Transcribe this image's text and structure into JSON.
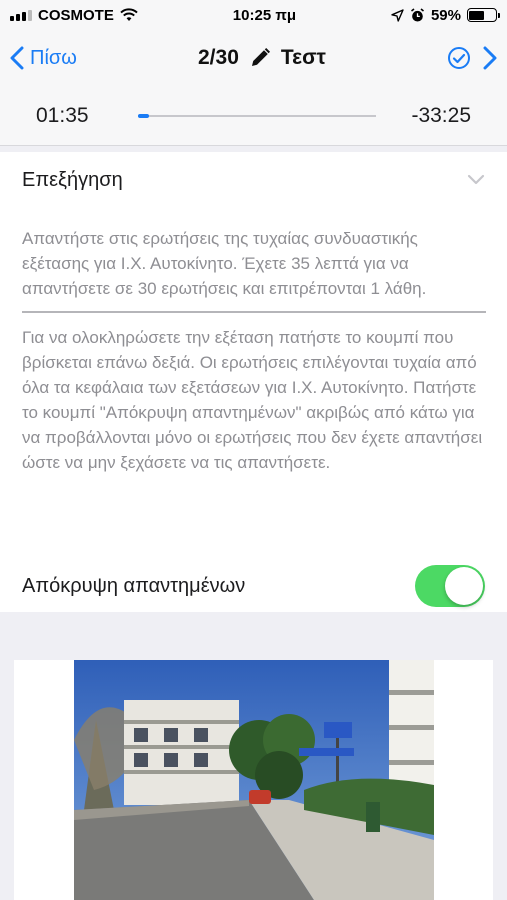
{
  "status_bar": {
    "carrier": "COSMOTE",
    "time": "10:25 πμ",
    "battery_percent": "59%",
    "battery_level": 0.59
  },
  "nav": {
    "back_label": "Πίσω",
    "counter": "2/30",
    "title": "Τεστ"
  },
  "timer": {
    "elapsed": "01:35",
    "remaining": "-33:25",
    "progress": 0.045
  },
  "explanation": {
    "heading": "Επεξήγηση",
    "paragraph_1": "Απαντήστε στις ερωτήσεις της τυχαίας συνδυαστικής εξέτασης για Ι.Χ. Αυτοκίνητο. Έχετε 35 λεπτά για να απαντήσετε σε 30 ερωτήσεις και επιτρέπονται 1 λάθη.",
    "paragraph_2": "Για να ολοκληρώσετε την εξέταση πατήστε το κουμπί που βρίσκεται επάνω δεξιά. Οι ερωτήσεις επιλέγονται τυχαία από όλα τα κεφάλαια των εξετάσεων για Ι.Χ. Αυτοκίνητο. Πατήστε το κουμπί \"Απόκρυψη απαντημένων\" ακριβώς από κάτω για να προβάλλονται μόνο οι ερωτήσεις που δεν έχετε απαντήσει ώστε να μην ξεχάσετε να τις απαντήσετε."
  },
  "hide_answered": {
    "label": "Απόκρυψη απαντημένων",
    "enabled": true
  },
  "colors": {
    "accent": "#1a7cf5",
    "toggle_on": "#4cd964"
  }
}
